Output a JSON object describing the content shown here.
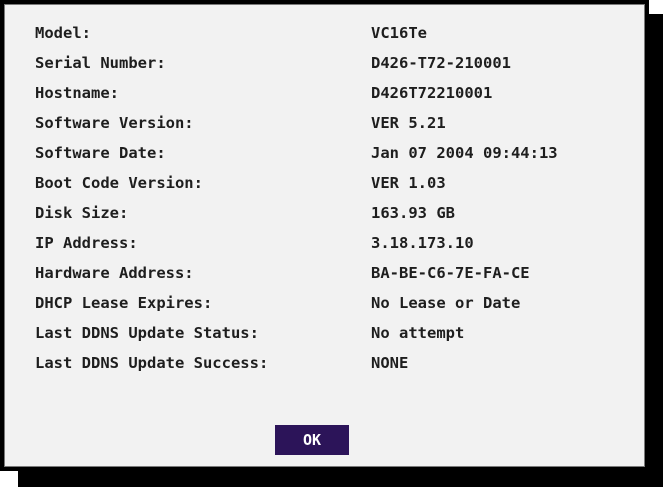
{
  "info": {
    "rows": [
      {
        "label": "Model:",
        "value": "VC16Te"
      },
      {
        "label": "Serial Number:",
        "value": "D426-T72-210001"
      },
      {
        "label": "Hostname:",
        "value": "D426T72210001"
      },
      {
        "label": "Software Version:",
        "value": "VER 5.21"
      },
      {
        "label": "Software Date:",
        "value": "Jan 07 2004 09:44:13"
      },
      {
        "label": "Boot Code Version:",
        "value": "VER 1.03"
      },
      {
        "label": "Disk Size:",
        "value": "163.93 GB"
      },
      {
        "label": "IP Address:",
        "value": "3.18.173.10"
      },
      {
        "label": "Hardware Address:",
        "value": "BA-BE-C6-7E-FA-CE"
      },
      {
        "label": "DHCP Lease Expires:",
        "value": "No Lease or Date"
      },
      {
        "label": "Last DDNS Update Status:",
        "value": "No attempt"
      },
      {
        "label": "Last DDNS Update Success:",
        "value": "NONE"
      }
    ]
  },
  "buttons": {
    "ok_label": "OK"
  },
  "colors": {
    "panel_background": "#f2f2f2",
    "border": "#000000",
    "text": "#1e1e1e",
    "ok_button_background": "#2c1459",
    "ok_button_text": "#ffffff"
  }
}
